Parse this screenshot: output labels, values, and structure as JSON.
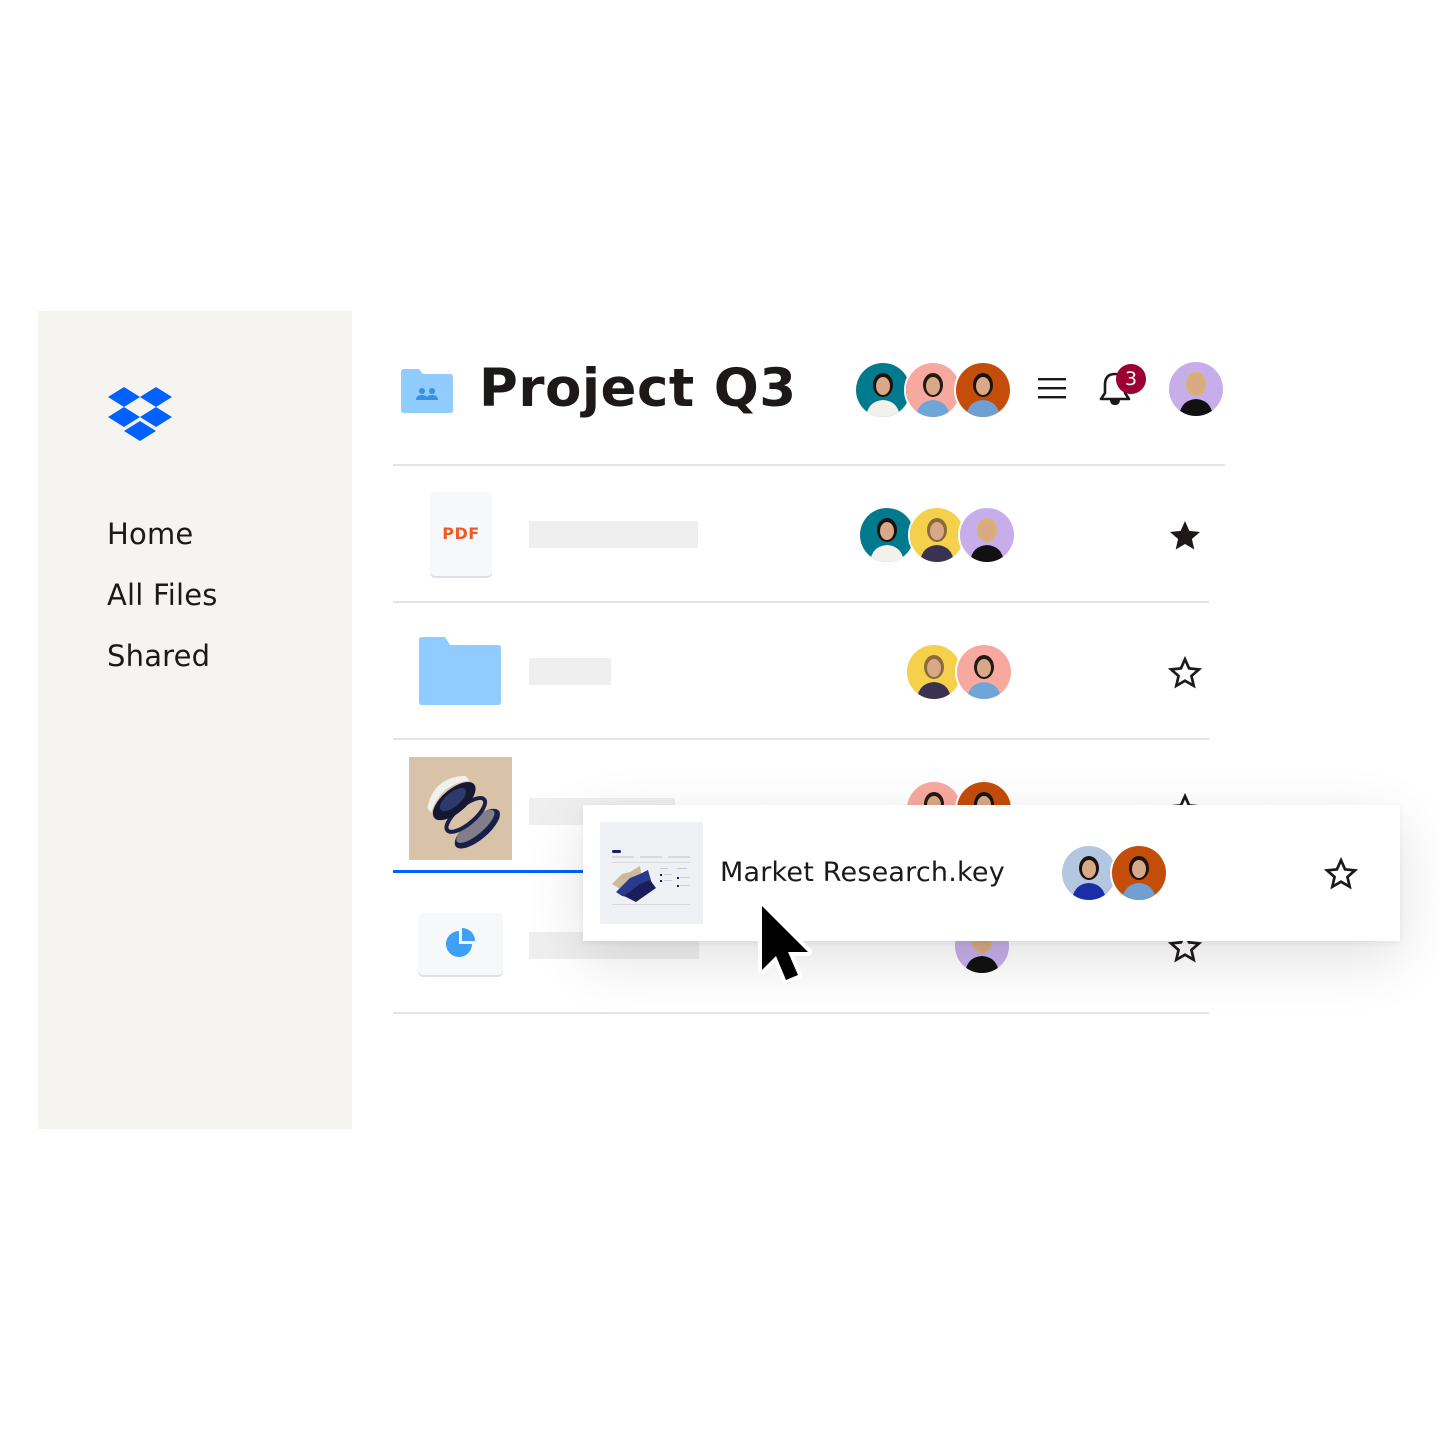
{
  "sidebar": {
    "logo": "dropbox-logo",
    "items": [
      {
        "label": "Home"
      },
      {
        "label": "All Files"
      },
      {
        "label": "Shared"
      }
    ]
  },
  "header": {
    "folder_icon": "shared-folder-icon",
    "title": "Project Q3",
    "members": [
      "teal",
      "pink",
      "orange"
    ],
    "menu_icon": "hamburger-menu-icon",
    "notifications": {
      "icon": "bell-icon",
      "count": "3"
    },
    "profile_avatar": "lavender"
  },
  "files": [
    {
      "type": "pdf",
      "icon_label": "PDF",
      "shared_with": [
        "teal",
        "yellow",
        "lavender"
      ],
      "starred": true
    },
    {
      "type": "folder",
      "shared_with": [
        "yellow",
        "pink"
      ],
      "starred": false
    },
    {
      "type": "image",
      "shared_with": [
        "pink",
        "orange"
      ],
      "starred": false
    },
    {
      "type": "chart",
      "shared_with": [
        "lavender"
      ],
      "starred": false
    }
  ],
  "dragged_file": {
    "name": "Market Research.key",
    "shared_with": [
      "blue",
      "orange"
    ],
    "starred": false
  },
  "colors": {
    "brand": "#0061fe",
    "sidebar_bg": "#f5f4f1",
    "badge": "#9b0032",
    "pdf_label": "#f15a24",
    "folder": "#90ccff",
    "avatar_teal": "#007a8c",
    "avatar_pink": "#f8a99f",
    "avatar_orange": "#c44d0a",
    "avatar_yellow": "#f5d04a",
    "avatar_lavender": "#c7aeea",
    "avatar_blue": "#b4c7e0"
  }
}
